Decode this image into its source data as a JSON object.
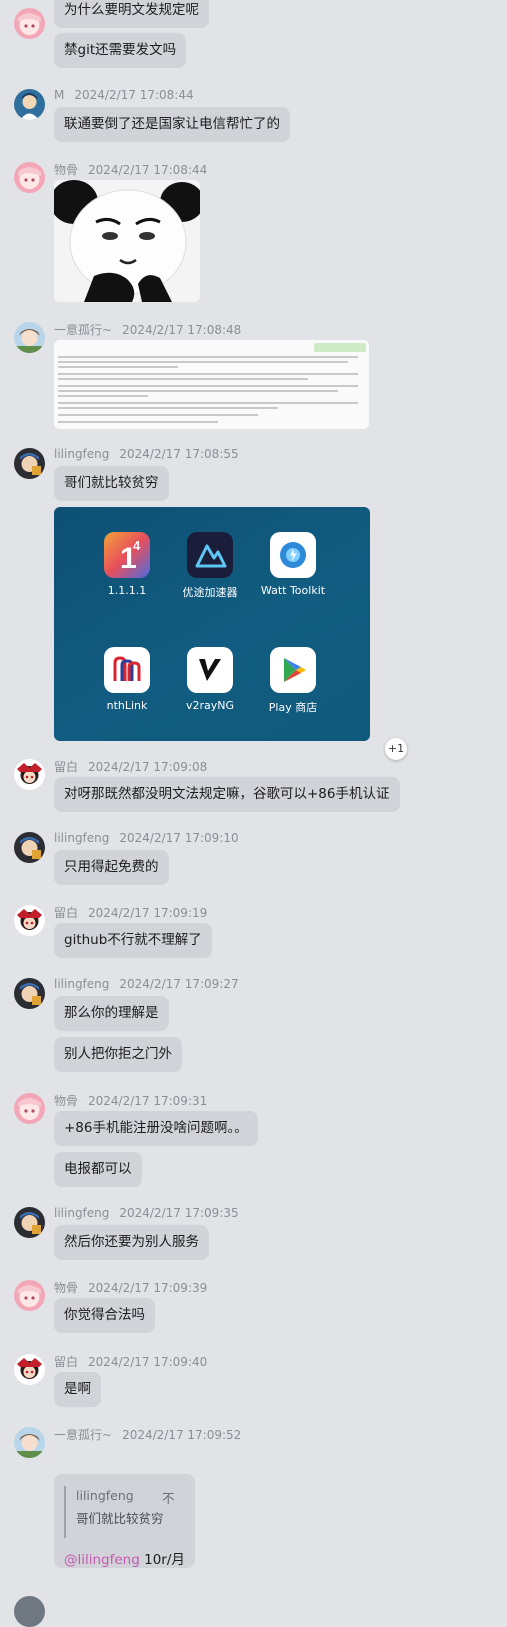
{
  "messages": {
    "m0": {
      "text1": "为什么要明文发规定呢",
      "text2": "禁git还需要发文吗"
    },
    "m1": {
      "name": "M",
      "time": "2024/2/17 17:08:44",
      "text": "联通要倒了还是国家让电信帮忙了的"
    },
    "m2": {
      "name": "物骨",
      "time": "2024/2/17 17:08:44"
    },
    "m3": {
      "name": "一意孤行~",
      "time": "2024/2/17 17:08:48"
    },
    "m4": {
      "name": "lilingfeng",
      "time": "2024/2/17 17:08:55",
      "text": "哥们就比较贫穷",
      "more_badge": "+1",
      "apps": [
        {
          "label": "1.1.1.1",
          "icon": "cloudflare-warp-icon"
        },
        {
          "label": "优途加速器",
          "icon": "youtu-accelerator-icon"
        },
        {
          "label": "Watt Toolkit",
          "icon": "watt-toolkit-icon"
        },
        {
          "label": "nthLink",
          "icon": "nthlink-icon"
        },
        {
          "label": "v2rayNG",
          "icon": "v2rayng-icon"
        },
        {
          "label": "Play 商店",
          "icon": "play-store-icon"
        }
      ]
    },
    "m5": {
      "name": "留白",
      "time": "2024/2/17 17:09:08",
      "text": "对呀那既然都没明文法规定嘛，谷歌可以+86手机认证"
    },
    "m6": {
      "name": "lilingfeng",
      "time": "2024/2/17 17:09:10",
      "text": "只用得起免费的"
    },
    "m7": {
      "name": "留白",
      "time": "2024/2/17 17:09:19",
      "text": "github不行就不理解了"
    },
    "m8": {
      "name": "lilingfeng",
      "time": "2024/2/17 17:09:27",
      "text1": "那么你的理解是",
      "text2": "别人把你拒之门外"
    },
    "m9": {
      "name": "物骨",
      "time": "2024/2/17 17:09:31",
      "text1": "+86手机能注册没啥问题啊。。",
      "text2": "电报都可以"
    },
    "m10": {
      "name": "lilingfeng",
      "time": "2024/2/17 17:09:35",
      "text": "然后你还要为别人服务"
    },
    "m11": {
      "name": "物骨",
      "time": "2024/2/17 17:09:39",
      "text": "你觉得合法吗"
    },
    "m12": {
      "name": "留白",
      "time": "2024/2/17 17:09:40",
      "text": "是啊"
    },
    "m13": {
      "name": "一意孤行~",
      "time": "2024/2/17 17:09:52",
      "quote_name": "lilingfeng",
      "quote_more": "不",
      "quote_text": "哥们就比较贫穷",
      "mention": "@lilingfeng",
      "text": " 10r/月"
    }
  },
  "colors": {
    "background": "#e2e3e7",
    "bubble": "#d1d3d8",
    "mention": "#c45ab3",
    "meta": "#8b8e94"
  }
}
